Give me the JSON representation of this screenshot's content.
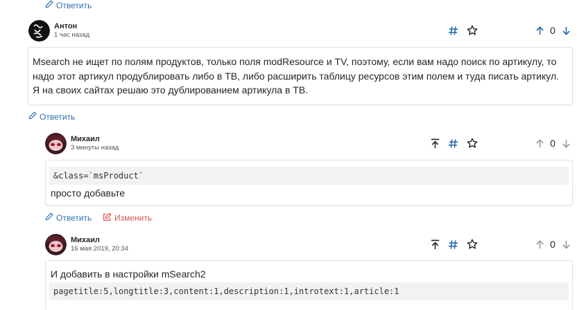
{
  "top_reply": {
    "label": "Ответить"
  },
  "comment1": {
    "author": "Антон",
    "time": "1 час назад",
    "rating": "0",
    "text": "Msearch не ищет по полям продуктов, только поля modResource и TV, поэтому, если вам надо поиск по артикулу, то надо этот артикул продублировать либо в ТВ, либо расширить таблицу ресурсов этим полем и туда писать артикул. Я на своих сайтах решаю это дублированием артикула в ТВ.",
    "reply_label": "Ответить"
  },
  "comment2": {
    "author": "Михаил",
    "time": "3 минуты назад",
    "rating": "0",
    "code": "&class=`msProduct`",
    "text": "просто добавьте",
    "reply_label": "Ответить",
    "edit_label": "Изменить"
  },
  "comment3": {
    "author": "Михаил",
    "time": "16 мая 2019, 20:34",
    "rating": "0",
    "text": "И добавить в настройки mSearch2",
    "code": "pagetitle:5,longtitle:3,content:1,description:1,introtext:1,article:1"
  },
  "colors": {
    "link": "#2a6fb0",
    "edit": "#d9534f",
    "hash": "#2a6fb0",
    "vote_up": "#2a6fb0",
    "vote_muted": "#9aa0a6"
  },
  "icons": [
    "pencil-icon",
    "edit-icon",
    "hash-icon",
    "star-icon",
    "arrow-up-icon",
    "arrow-down-icon",
    "to-parent-icon"
  ]
}
